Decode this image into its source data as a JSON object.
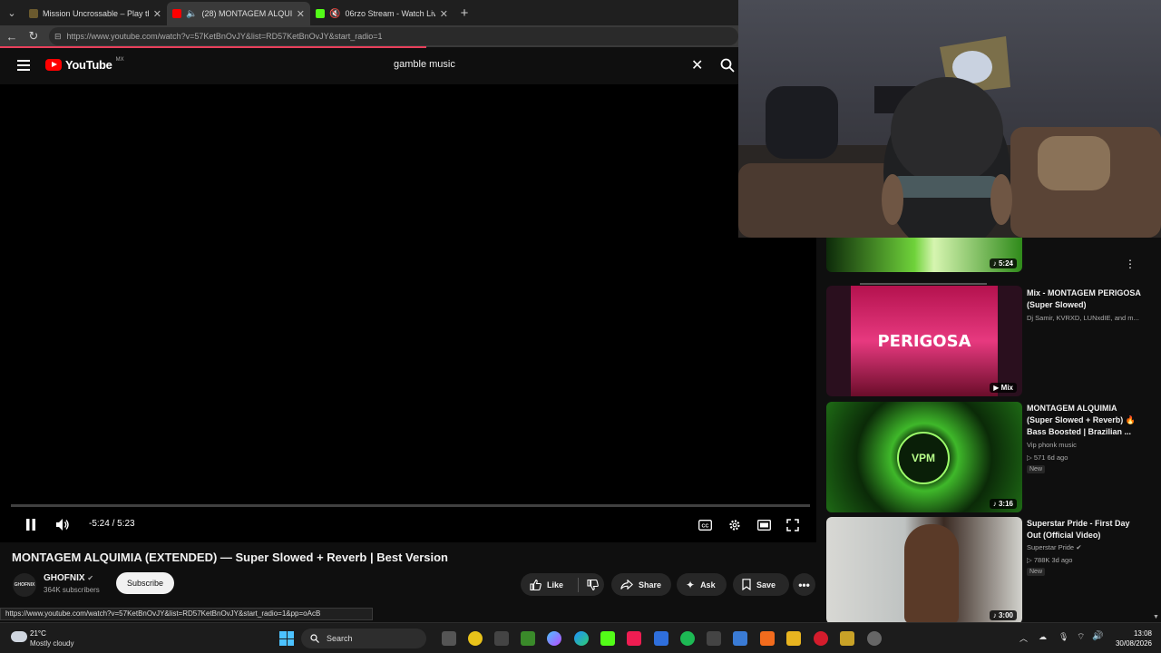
{
  "browser": {
    "tabs": [
      {
        "title": "Mission Uncrossable – Play the Ro",
        "active": false
      },
      {
        "title": "(28) MONTAGEM ALQUIMIA (",
        "active": true
      },
      {
        "title": "06rzo Stream - Watch Live on",
        "active": false
      }
    ],
    "url": "https://www.youtube.com/watch?v=57KetBnOvJY&list=RD57KetBnOvJY&start_radio=1"
  },
  "header": {
    "logo_text": "YouTube",
    "country": "MX",
    "search_query": "gamble music"
  },
  "player": {
    "time": "-5:24 / 5:23"
  },
  "video": {
    "title": "MONTAGEM ALQUIMIA (EXTENDED) — Super Slowed + Reverb | Best Version",
    "channel": "GHOFNIX",
    "avatar_text": "GHOFNIX",
    "subscribers": "364K subscribers",
    "subscribe_label": "Subscribe",
    "like_label": "Like",
    "share_label": "Share",
    "ask_label": "Ask",
    "save_label": "Save"
  },
  "status_url": "https://www.youtube.com/watch?v=57KetBnOvJY&list=RD57KetBnOvJY&start_radio=1&pp=oAcB",
  "sidebar": {
    "items": [
      {
        "duration": "5:24"
      },
      {
        "title": "Mix - MONTAGEM PERIGOSA (Super Slowed)",
        "meta": "Dj Samir, KVRXD, LUNxdIE, and m...",
        "duration": "Mix",
        "art_text": "PERIGOSA"
      },
      {
        "title": "MONTAGEM ALQUIMIA (Super Slowed + Reverb) 🔥 Bass Boosted | Brazilian ...",
        "channel": "Vip phonk music",
        "views": "571  6d ago",
        "new": "New",
        "duration": "3:16",
        "art_text": "VPM"
      },
      {
        "title": "Superstar Pride - First Day Out (Official Video)",
        "channel": "Superstar Pride",
        "views": "788K  3d ago",
        "new": "New",
        "duration": "3:00"
      }
    ]
  },
  "taskbar": {
    "temperature": "21°C",
    "weather": "Mostly cloudy",
    "search_label": "Search",
    "time": "13:08",
    "date": "30/08/2026"
  }
}
